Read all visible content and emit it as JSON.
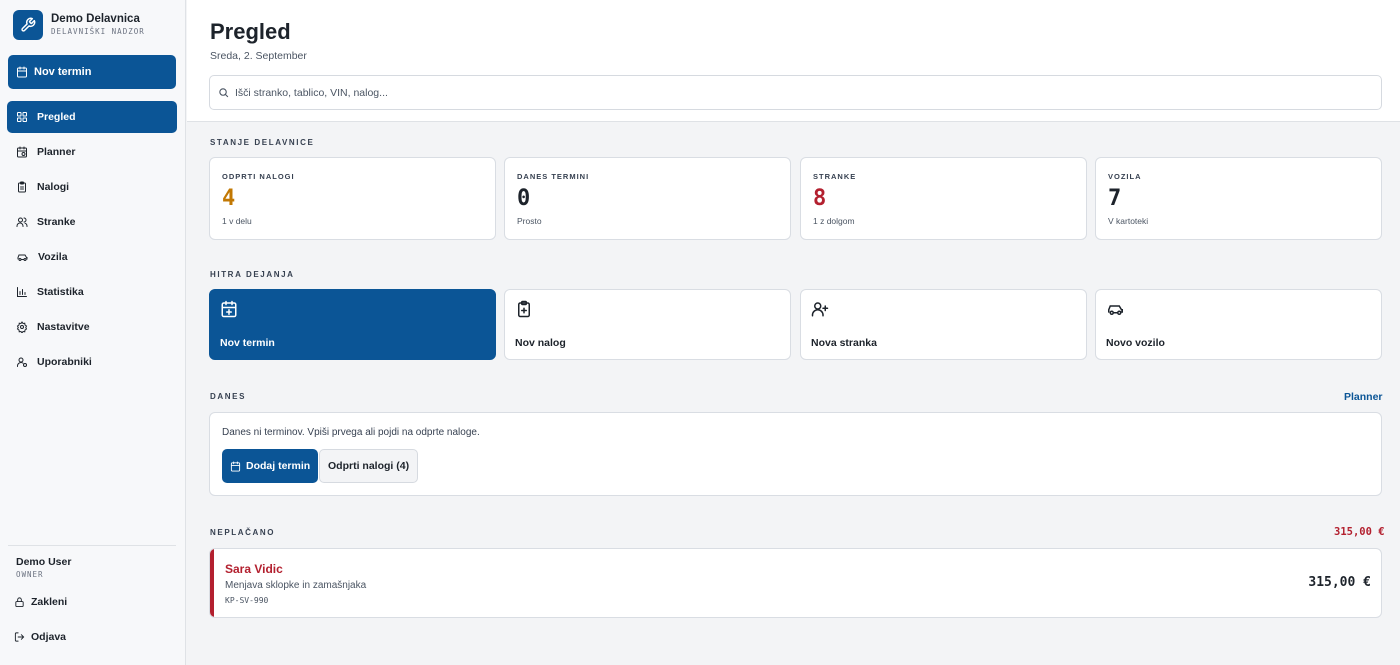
{
  "brand": {
    "name": "Demo Delavnica",
    "subtitle": "DELAVNIŠKI NADZOR"
  },
  "sidebar": {
    "new_button": "Nov termin",
    "items": [
      {
        "label": "Pregled",
        "icon": "grid-icon",
        "active": true
      },
      {
        "label": "Planner",
        "icon": "calendar-clock-icon"
      },
      {
        "label": "Nalogi",
        "icon": "clipboard-icon"
      },
      {
        "label": "Stranke",
        "icon": "users-icon"
      },
      {
        "label": "Vozila",
        "icon": "car-icon"
      },
      {
        "label": "Statistika",
        "icon": "bar-chart-icon"
      },
      {
        "label": "Nastavitve",
        "icon": "gear-icon"
      },
      {
        "label": "Uporabniki",
        "icon": "user-cog-icon"
      }
    ],
    "user": {
      "name": "Demo User",
      "role": "OWNER"
    },
    "lock_label": "Zakleni",
    "logout_label": "Odjava"
  },
  "header": {
    "title": "Pregled",
    "date": "Sreda, 2. September",
    "search_placeholder": "Išči stranko, tablico, VIN, nalog..."
  },
  "status": {
    "label": "STANJE DELAVNICE",
    "cards": [
      {
        "label": "ODPRTI NALOGI",
        "value": "4",
        "sub": "1 v delu",
        "color": "#c27803"
      },
      {
        "label": "DANES TERMINI",
        "value": "0",
        "sub": "Prosto",
        "color": "#1d232b"
      },
      {
        "label": "STRANKE",
        "value": "8",
        "sub": "1 z dolgom",
        "color": "#b3202f"
      },
      {
        "label": "VOZILA",
        "value": "7",
        "sub": "V kartoteki",
        "color": "#1d232b"
      }
    ]
  },
  "quick": {
    "label": "HITRA DEJANJA",
    "actions": [
      {
        "label": "Nov termin",
        "icon": "calendar-plus-icon"
      },
      {
        "label": "Nov nalog",
        "icon": "clipboard-plus-icon"
      },
      {
        "label": "Nova stranka",
        "icon": "user-plus-icon"
      },
      {
        "label": "Novo vozilo",
        "icon": "car-icon"
      }
    ]
  },
  "today": {
    "label": "DANES",
    "planner_link": "Planner",
    "empty_text": "Danes ni terminov. Vpiši prvega ali pojdi na odprte naloge.",
    "add_button": "Dodaj termin",
    "open_orders_button": "Odprti nalogi (4)"
  },
  "unpaid": {
    "label": "NEPLAČANO",
    "total": "315,00 €",
    "items": [
      {
        "customer": "Sara Vidic",
        "description": "Menjava sklopke in zamašnjaka",
        "plate": "KP-SV-990",
        "amount": "315,00 €"
      }
    ]
  },
  "colors": {
    "accent": "#0b5596",
    "warning": "#c27803",
    "danger": "#b3202f"
  }
}
